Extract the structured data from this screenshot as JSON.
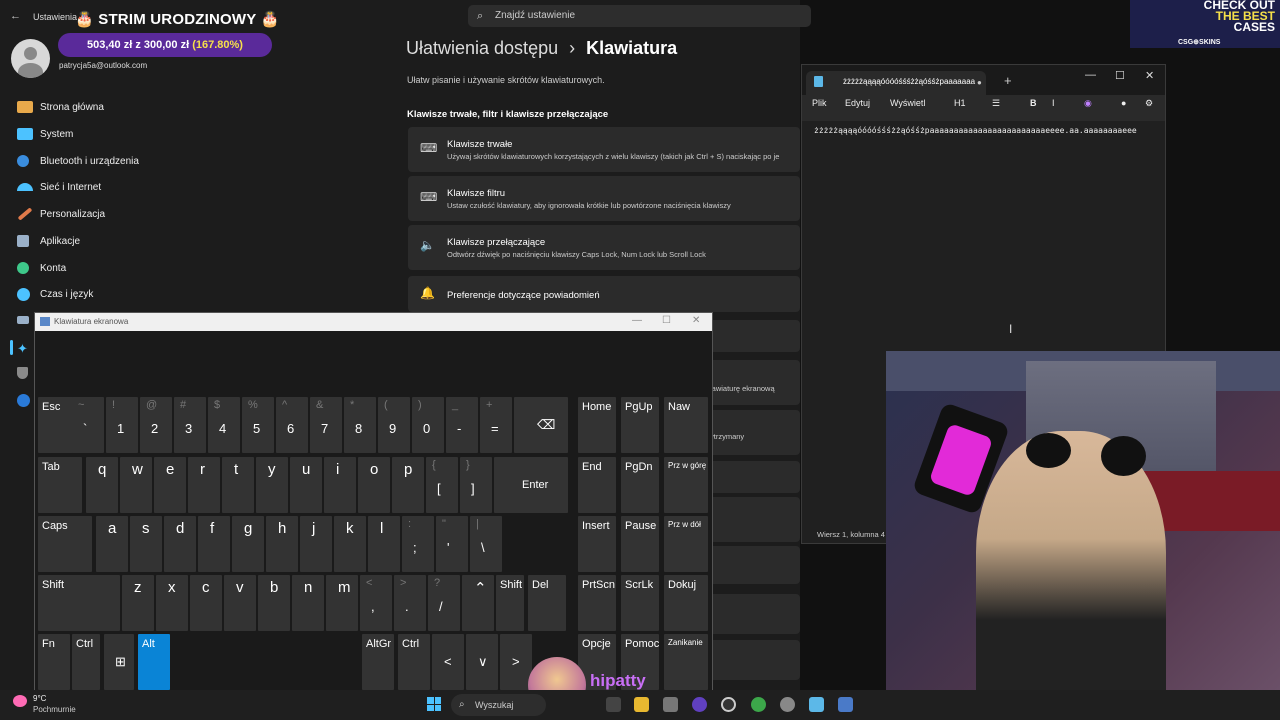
{
  "settings": {
    "window_title": "Ustawienia",
    "stream_banner": "🎂 STRIM URODZINOWY 🎂",
    "donation_text": "503,40 zł z 300,00 zł",
    "donation_pct": "(167.80%)",
    "account_email": "patrycja5a@outlook.com",
    "search_placeholder": "Znajdź ustawienie",
    "nav": [
      {
        "label": "Strona główna",
        "icon": "home-icon",
        "color": "#e8a94b"
      },
      {
        "label": "System",
        "icon": "system-icon",
        "color": "#4cc2ff"
      },
      {
        "label": "Bluetooth i urządzenia",
        "icon": "bluetooth-icon",
        "color": "#3a8dde"
      },
      {
        "label": "Sieć i Internet",
        "icon": "wifi-icon",
        "color": "#4cc2ff"
      },
      {
        "label": "Personalizacja",
        "icon": "brush-icon",
        "color": "#e07a4a"
      },
      {
        "label": "Aplikacje",
        "icon": "apps-icon",
        "color": "#9ab0c8"
      },
      {
        "label": "Konta",
        "icon": "account-icon",
        "color": "#3ec88a"
      },
      {
        "label": "Czas i język",
        "icon": "globe-clock-icon",
        "color": "#4cc2ff"
      }
    ],
    "breadcrumb_parent": "Ułatwienia dostępu",
    "breadcrumb_sep": "›",
    "breadcrumb_current": "Klawiatura",
    "subtitle": "Ułatw pisanie i używanie skrótów klawiaturowych.",
    "section_title": "Klawisze trwałe, filtr i klawisze przełączające",
    "cards": [
      {
        "title": "Klawisze trwałe",
        "desc": "Używaj skrótów klawiaturowych korzystających z wielu klawiszy (takich jak Ctrl + S) naciskając po je",
        "icon": "keyboard-icon"
      },
      {
        "title": "Klawisze filtru",
        "desc": "Ustaw czułość klawiatury, aby ignorowała krótkie lub powtórzone naciśnięcia klawiszy",
        "icon": "keyboard-filter-icon"
      },
      {
        "title": "Klawisze przełączające",
        "desc": "Odtwórz dźwięk po naciśnięciu klawiszy Caps Lock, Num Lock lub Scroll Lock",
        "icon": "speaker-icon"
      },
      {
        "title": "Preferencje dotyczące powiadomień",
        "desc": "",
        "icon": "bell-icon"
      }
    ],
    "partial_rows": [
      "lawiaturę ekranową",
      "ytrzymany"
    ]
  },
  "notepad": {
    "tab_title": "żżżżżąąąąóóóóśśśżżąóśśżpaaaaaaa",
    "menu": [
      "Plik",
      "Edytuj",
      "Wyświetl",
      "H1"
    ],
    "text": "żżżżżąąąąóóóóśśśżżąóśśżpaaaaaaaaaaaaaaaaaaaaaaaaeeee.aa.aaaaaaaaeee",
    "status": "Wiersz 1, kolumna 4"
  },
  "osk": {
    "title": "Klawiatura ekranowa",
    "rows": [
      [
        {
          "m": "Esc",
          "s": ""
        },
        {
          "m": "`",
          "s": "~"
        },
        {
          "m": "1",
          "s": "!"
        },
        {
          "m": "2",
          "s": "@"
        },
        {
          "m": "3",
          "s": "#"
        },
        {
          "m": "4",
          "s": "$"
        },
        {
          "m": "5",
          "s": "%"
        },
        {
          "m": "6",
          "s": "^"
        },
        {
          "m": "7",
          "s": "&"
        },
        {
          "m": "8",
          "s": "*"
        },
        {
          "m": "9",
          "s": "("
        },
        {
          "m": "0",
          "s": ")"
        },
        {
          "m": "-",
          "s": "_"
        },
        {
          "m": "=",
          "s": "+"
        },
        {
          "m": "⌫",
          "s": ""
        },
        {
          "m": "Home",
          "s": ""
        },
        {
          "m": "PgUp",
          "s": ""
        },
        {
          "m": "Naw",
          "s": ""
        }
      ],
      [
        {
          "m": "Tab"
        },
        {
          "m": "q"
        },
        {
          "m": "w"
        },
        {
          "m": "e"
        },
        {
          "m": "r"
        },
        {
          "m": "t"
        },
        {
          "m": "y"
        },
        {
          "m": "u"
        },
        {
          "m": "i"
        },
        {
          "m": "o"
        },
        {
          "m": "p"
        },
        {
          "m": "[",
          "s": "{"
        },
        {
          "m": "]",
          "s": "}"
        },
        {
          "m": "Enter"
        },
        {
          "m": "End"
        },
        {
          "m": "PgDn"
        },
        {
          "m": "Prz w górę"
        }
      ],
      [
        {
          "m": "Caps"
        },
        {
          "m": "a"
        },
        {
          "m": "s"
        },
        {
          "m": "d"
        },
        {
          "m": "f"
        },
        {
          "m": "g"
        },
        {
          "m": "h"
        },
        {
          "m": "j"
        },
        {
          "m": "k"
        },
        {
          "m": "l"
        },
        {
          "m": ";",
          "s": ":"
        },
        {
          "m": "'",
          "s": "\""
        },
        {
          "m": "\\",
          "s": "|"
        },
        {
          "m": "Insert"
        },
        {
          "m": "Pause"
        },
        {
          "m": "Prz w dół"
        }
      ],
      [
        {
          "m": "Shift"
        },
        {
          "m": "z"
        },
        {
          "m": "x"
        },
        {
          "m": "c"
        },
        {
          "m": "v"
        },
        {
          "m": "b"
        },
        {
          "m": "n"
        },
        {
          "m": "m"
        },
        {
          "m": ",",
          "s": "<"
        },
        {
          "m": ".",
          "s": ">"
        },
        {
          "m": "/",
          "s": "?"
        },
        {
          "m": "⌃"
        },
        {
          "m": "Shift"
        },
        {
          "m": "Del"
        },
        {
          "m": "PrtScn"
        },
        {
          "m": "ScrLk"
        },
        {
          "m": "Dokuj"
        }
      ],
      [
        {
          "m": "Fn"
        },
        {
          "m": "Ctrl"
        },
        {
          "m": "⊞"
        },
        {
          "m": "Alt"
        },
        {
          "m": "AltGr"
        },
        {
          "m": "Ctrl"
        },
        {
          "m": "<"
        },
        {
          "m": "∨"
        },
        {
          "m": ">"
        },
        {
          "m": "Opcje"
        },
        {
          "m": "Pomoc"
        },
        {
          "m": "Zanikanie"
        }
      ]
    ],
    "active_key": "Alt",
    "active_color": "#0a84d6"
  },
  "ad": {
    "text_lines": [
      "CHECK OUT",
      "THE BEST",
      "CASES"
    ],
    "logo": "CSG⊕SKINS",
    "highlight_color": "#f6e04a"
  },
  "overlay": {
    "streamer_name": "hipatty"
  },
  "taskbar": {
    "temp": "9°C",
    "weather": "Pochmurnie",
    "search": "Wyszukaj"
  }
}
